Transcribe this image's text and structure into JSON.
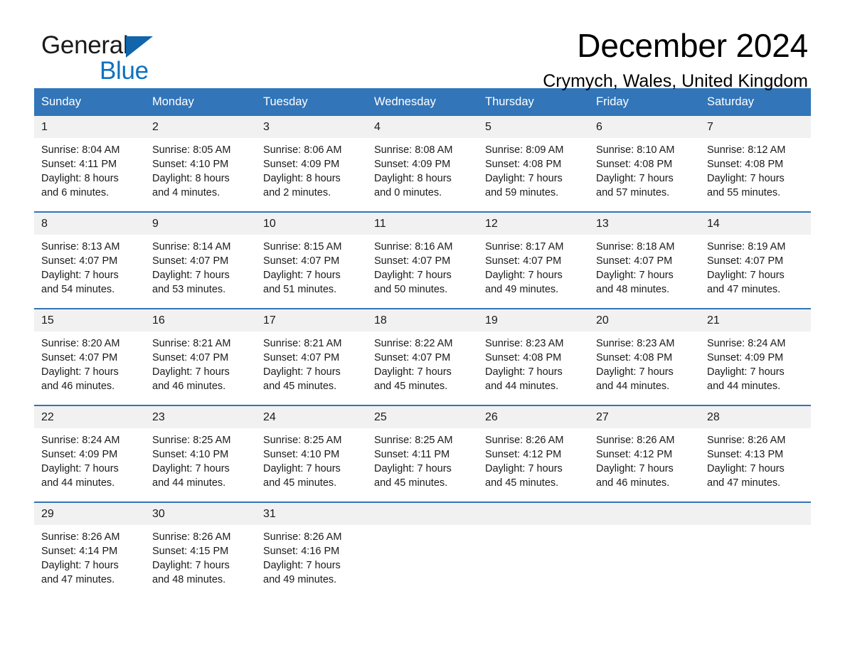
{
  "brand": {
    "name_part1": "General",
    "name_part2": "Blue",
    "accent_color": "#1071c0",
    "triangle_color": "#1065ab"
  },
  "header": {
    "month_title": "December 2024",
    "location": "Crymych, Wales, United Kingdom"
  },
  "calendar": {
    "header_color": "#3275b8",
    "daynum_band_color": "#f1f1f1",
    "weekday_headers": [
      "Sunday",
      "Monday",
      "Tuesday",
      "Wednesday",
      "Thursday",
      "Friday",
      "Saturday"
    ],
    "weeks": [
      [
        {
          "day": "1",
          "sunrise": "Sunrise: 8:04 AM",
          "sunset": "Sunset: 4:11 PM",
          "daylight_line1": "Daylight: 8 hours",
          "daylight_line2": "and 6 minutes."
        },
        {
          "day": "2",
          "sunrise": "Sunrise: 8:05 AM",
          "sunset": "Sunset: 4:10 PM",
          "daylight_line1": "Daylight: 8 hours",
          "daylight_line2": "and 4 minutes."
        },
        {
          "day": "3",
          "sunrise": "Sunrise: 8:06 AM",
          "sunset": "Sunset: 4:09 PM",
          "daylight_line1": "Daylight: 8 hours",
          "daylight_line2": "and 2 minutes."
        },
        {
          "day": "4",
          "sunrise": "Sunrise: 8:08 AM",
          "sunset": "Sunset: 4:09 PM",
          "daylight_line1": "Daylight: 8 hours",
          "daylight_line2": "and 0 minutes."
        },
        {
          "day": "5",
          "sunrise": "Sunrise: 8:09 AM",
          "sunset": "Sunset: 4:08 PM",
          "daylight_line1": "Daylight: 7 hours",
          "daylight_line2": "and 59 minutes."
        },
        {
          "day": "6",
          "sunrise": "Sunrise: 8:10 AM",
          "sunset": "Sunset: 4:08 PM",
          "daylight_line1": "Daylight: 7 hours",
          "daylight_line2": "and 57 minutes."
        },
        {
          "day": "7",
          "sunrise": "Sunrise: 8:12 AM",
          "sunset": "Sunset: 4:08 PM",
          "daylight_line1": "Daylight: 7 hours",
          "daylight_line2": "and 55 minutes."
        }
      ],
      [
        {
          "day": "8",
          "sunrise": "Sunrise: 8:13 AM",
          "sunset": "Sunset: 4:07 PM",
          "daylight_line1": "Daylight: 7 hours",
          "daylight_line2": "and 54 minutes."
        },
        {
          "day": "9",
          "sunrise": "Sunrise: 8:14 AM",
          "sunset": "Sunset: 4:07 PM",
          "daylight_line1": "Daylight: 7 hours",
          "daylight_line2": "and 53 minutes."
        },
        {
          "day": "10",
          "sunrise": "Sunrise: 8:15 AM",
          "sunset": "Sunset: 4:07 PM",
          "daylight_line1": "Daylight: 7 hours",
          "daylight_line2": "and 51 minutes."
        },
        {
          "day": "11",
          "sunrise": "Sunrise: 8:16 AM",
          "sunset": "Sunset: 4:07 PM",
          "daylight_line1": "Daylight: 7 hours",
          "daylight_line2": "and 50 minutes."
        },
        {
          "day": "12",
          "sunrise": "Sunrise: 8:17 AM",
          "sunset": "Sunset: 4:07 PM",
          "daylight_line1": "Daylight: 7 hours",
          "daylight_line2": "and 49 minutes."
        },
        {
          "day": "13",
          "sunrise": "Sunrise: 8:18 AM",
          "sunset": "Sunset: 4:07 PM",
          "daylight_line1": "Daylight: 7 hours",
          "daylight_line2": "and 48 minutes."
        },
        {
          "day": "14",
          "sunrise": "Sunrise: 8:19 AM",
          "sunset": "Sunset: 4:07 PM",
          "daylight_line1": "Daylight: 7 hours",
          "daylight_line2": "and 47 minutes."
        }
      ],
      [
        {
          "day": "15",
          "sunrise": "Sunrise: 8:20 AM",
          "sunset": "Sunset: 4:07 PM",
          "daylight_line1": "Daylight: 7 hours",
          "daylight_line2": "and 46 minutes."
        },
        {
          "day": "16",
          "sunrise": "Sunrise: 8:21 AM",
          "sunset": "Sunset: 4:07 PM",
          "daylight_line1": "Daylight: 7 hours",
          "daylight_line2": "and 46 minutes."
        },
        {
          "day": "17",
          "sunrise": "Sunrise: 8:21 AM",
          "sunset": "Sunset: 4:07 PM",
          "daylight_line1": "Daylight: 7 hours",
          "daylight_line2": "and 45 minutes."
        },
        {
          "day": "18",
          "sunrise": "Sunrise: 8:22 AM",
          "sunset": "Sunset: 4:07 PM",
          "daylight_line1": "Daylight: 7 hours",
          "daylight_line2": "and 45 minutes."
        },
        {
          "day": "19",
          "sunrise": "Sunrise: 8:23 AM",
          "sunset": "Sunset: 4:08 PM",
          "daylight_line1": "Daylight: 7 hours",
          "daylight_line2": "and 44 minutes."
        },
        {
          "day": "20",
          "sunrise": "Sunrise: 8:23 AM",
          "sunset": "Sunset: 4:08 PM",
          "daylight_line1": "Daylight: 7 hours",
          "daylight_line2": "and 44 minutes."
        },
        {
          "day": "21",
          "sunrise": "Sunrise: 8:24 AM",
          "sunset": "Sunset: 4:09 PM",
          "daylight_line1": "Daylight: 7 hours",
          "daylight_line2": "and 44 minutes."
        }
      ],
      [
        {
          "day": "22",
          "sunrise": "Sunrise: 8:24 AM",
          "sunset": "Sunset: 4:09 PM",
          "daylight_line1": "Daylight: 7 hours",
          "daylight_line2": "and 44 minutes."
        },
        {
          "day": "23",
          "sunrise": "Sunrise: 8:25 AM",
          "sunset": "Sunset: 4:10 PM",
          "daylight_line1": "Daylight: 7 hours",
          "daylight_line2": "and 44 minutes."
        },
        {
          "day": "24",
          "sunrise": "Sunrise: 8:25 AM",
          "sunset": "Sunset: 4:10 PM",
          "daylight_line1": "Daylight: 7 hours",
          "daylight_line2": "and 45 minutes."
        },
        {
          "day": "25",
          "sunrise": "Sunrise: 8:25 AM",
          "sunset": "Sunset: 4:11 PM",
          "daylight_line1": "Daylight: 7 hours",
          "daylight_line2": "and 45 minutes."
        },
        {
          "day": "26",
          "sunrise": "Sunrise: 8:26 AM",
          "sunset": "Sunset: 4:12 PM",
          "daylight_line1": "Daylight: 7 hours",
          "daylight_line2": "and 45 minutes."
        },
        {
          "day": "27",
          "sunrise": "Sunrise: 8:26 AM",
          "sunset": "Sunset: 4:12 PM",
          "daylight_line1": "Daylight: 7 hours",
          "daylight_line2": "and 46 minutes."
        },
        {
          "day": "28",
          "sunrise": "Sunrise: 8:26 AM",
          "sunset": "Sunset: 4:13 PM",
          "daylight_line1": "Daylight: 7 hours",
          "daylight_line2": "and 47 minutes."
        }
      ],
      [
        {
          "day": "29",
          "sunrise": "Sunrise: 8:26 AM",
          "sunset": "Sunset: 4:14 PM",
          "daylight_line1": "Daylight: 7 hours",
          "daylight_line2": "and 47 minutes."
        },
        {
          "day": "30",
          "sunrise": "Sunrise: 8:26 AM",
          "sunset": "Sunset: 4:15 PM",
          "daylight_line1": "Daylight: 7 hours",
          "daylight_line2": "and 48 minutes."
        },
        {
          "day": "31",
          "sunrise": "Sunrise: 8:26 AM",
          "sunset": "Sunset: 4:16 PM",
          "daylight_line1": "Daylight: 7 hours",
          "daylight_line2": "and 49 minutes."
        },
        {
          "day": "",
          "sunrise": "",
          "sunset": "",
          "daylight_line1": "",
          "daylight_line2": ""
        },
        {
          "day": "",
          "sunrise": "",
          "sunset": "",
          "daylight_line1": "",
          "daylight_line2": ""
        },
        {
          "day": "",
          "sunrise": "",
          "sunset": "",
          "daylight_line1": "",
          "daylight_line2": ""
        },
        {
          "day": "",
          "sunrise": "",
          "sunset": "",
          "daylight_line1": "",
          "daylight_line2": ""
        }
      ]
    ]
  }
}
